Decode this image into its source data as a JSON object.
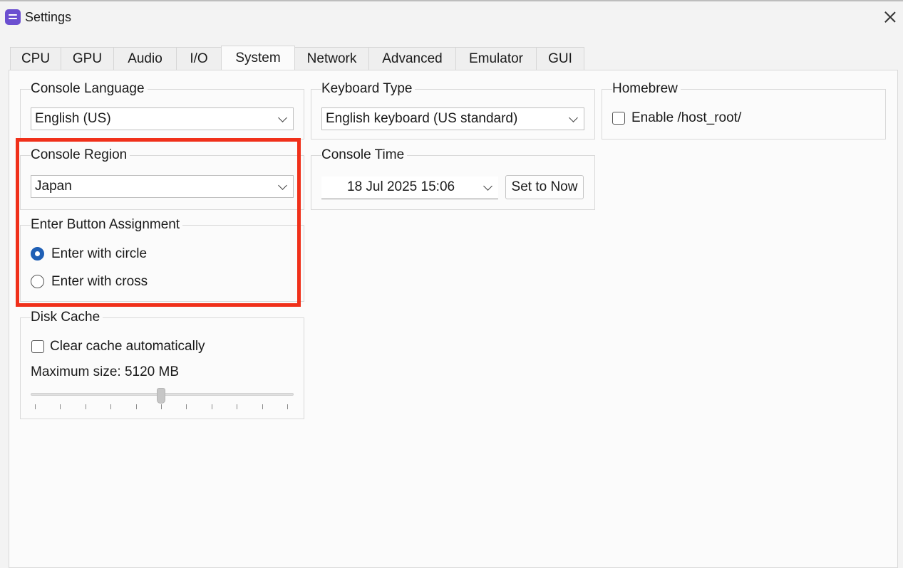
{
  "window": {
    "title": "Settings",
    "icon": "app-icon",
    "close_icon": "close-icon"
  },
  "tabs": [
    {
      "label": "CPU",
      "active": false
    },
    {
      "label": "GPU",
      "active": false
    },
    {
      "label": "Audio",
      "active": false
    },
    {
      "label": "I/O",
      "active": false
    },
    {
      "label": "System",
      "active": true
    },
    {
      "label": "Network",
      "active": false
    },
    {
      "label": "Advanced",
      "active": false
    },
    {
      "label": "Emulator",
      "active": false
    },
    {
      "label": "GUI",
      "active": false
    }
  ],
  "console_language": {
    "title": "Console Language",
    "value": "English (US)"
  },
  "keyboard_type": {
    "title": "Keyboard Type",
    "value": "English keyboard (US standard)"
  },
  "homebrew": {
    "title": "Homebrew",
    "enable_host_root_label": "Enable /host_root/",
    "enable_host_root_checked": false
  },
  "console_region": {
    "title": "Console Region",
    "value": "Japan"
  },
  "console_time": {
    "title": "Console Time",
    "value": "18 Jul 2025 15:06",
    "set_now_label": "Set to Now"
  },
  "enter_button": {
    "title": "Enter Button Assignment",
    "options": [
      {
        "label": "Enter with circle",
        "selected": true
      },
      {
        "label": "Enter with cross",
        "selected": false
      }
    ]
  },
  "disk_cache": {
    "title": "Disk Cache",
    "clear_auto_label": "Clear cache automatically",
    "clear_auto_checked": false,
    "max_size_label": "Maximum size: 5120 MB",
    "slider_fraction": 0.5,
    "slider_ticks": 11
  },
  "colors": {
    "accent": "#1f5fb5",
    "highlight": "#f0301a",
    "app_icon": "#6b4fd0"
  }
}
